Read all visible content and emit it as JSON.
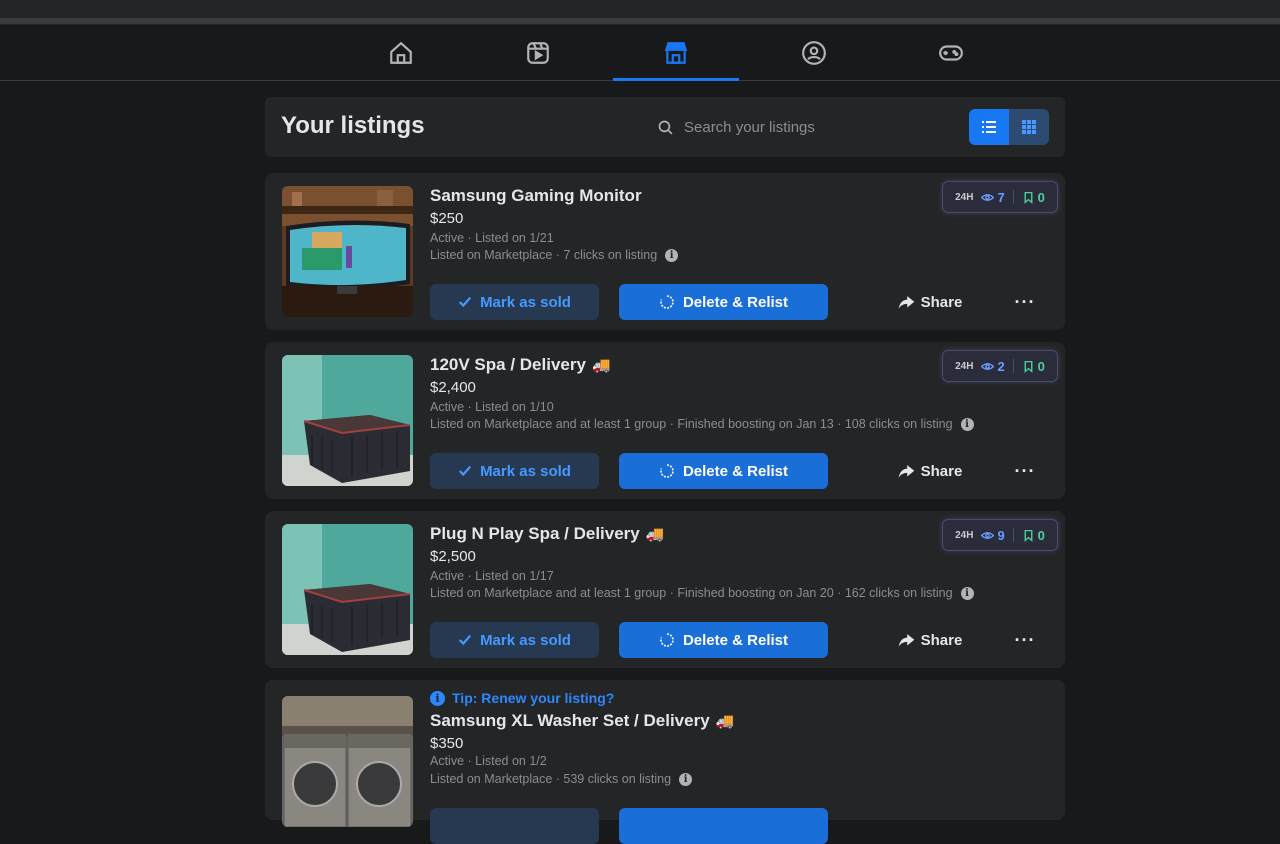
{
  "nav": {
    "tabs": [
      {
        "icon": "home-icon",
        "active": false
      },
      {
        "icon": "video-icon",
        "active": false
      },
      {
        "icon": "marketplace-icon",
        "active": true
      },
      {
        "icon": "groups-icon",
        "active": false
      },
      {
        "icon": "gaming-icon",
        "active": false
      }
    ]
  },
  "header": {
    "title": "Your listings",
    "search_placeholder": "Search your listings"
  },
  "stats_label": "24H",
  "buttons": {
    "mark_sold": "Mark as sold",
    "relist": "Delete & Relist",
    "share": "Share",
    "more": "···"
  },
  "listings": [
    {
      "title": "Samsung Gaming Monitor",
      "truck": "",
      "price": "$250",
      "status": "Active · Listed on 1/21",
      "meta": "Listed on Marketplace · 7 clicks on listing",
      "views": "7",
      "saves": "0"
    },
    {
      "title": "120V Spa / Delivery",
      "truck": "🚚",
      "price": "$2,400",
      "status": "Active · Listed on 1/10",
      "meta": "Listed on Marketplace and at least 1 group · Finished boosting on Jan 13 · 108 clicks on listing",
      "views": "2",
      "saves": "0"
    },
    {
      "title": "Plug N Play Spa / Delivery",
      "truck": "🚚",
      "price": "$2,500",
      "status": "Active · Listed on 1/17",
      "meta": "Listed on Marketplace and at least 1 group · Finished boosting on Jan 20 · 162 clicks on listing",
      "views": "9",
      "saves": "0"
    },
    {
      "tip": "Tip: Renew your listing?",
      "title": "Samsung XL Washer Set / Delivery",
      "truck": "🚚",
      "price": "$350",
      "status": "Active · Listed on 1/2",
      "meta": "Listed on Marketplace · 539 clicks on listing"
    }
  ],
  "colors": {
    "accent": "#1877f2",
    "background": "#18191a",
    "card": "#242526"
  }
}
